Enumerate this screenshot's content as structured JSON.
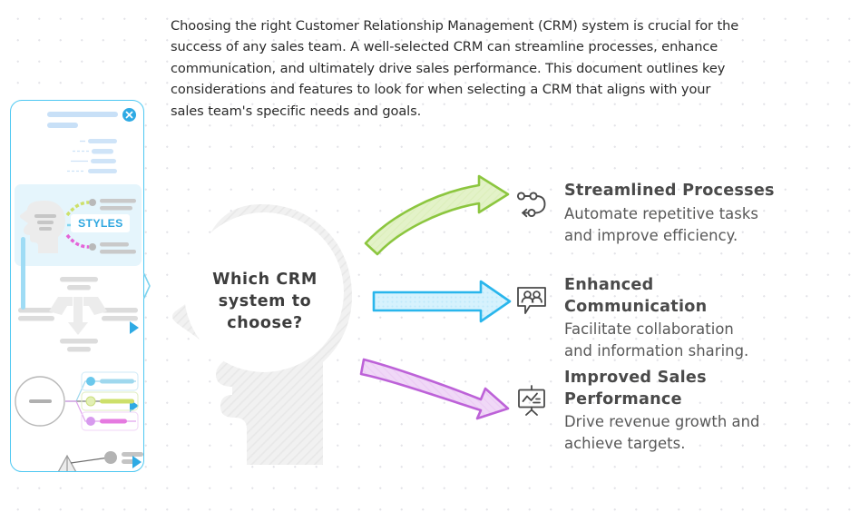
{
  "intro": {
    "paragraph": "Choosing the right Customer Relationship Management (CRM) system is crucial for the success of any sales team. A well-selected CRM can streamline processes, enhance communication, and ultimately drive sales performance. This document outlines key considerations and features to look for when selecting a CRM that aligns with your sales team's specific needs and goals."
  },
  "central": {
    "question": "Which CRM\nsystem to\nchoose?",
    "shape": "head-silhouette"
  },
  "benefits": [
    {
      "icon": "process-loop-icon",
      "title": "Streamlined Processes",
      "description": "Automate repetitive tasks\nand improve efficiency.",
      "arrow": "curved-up-arrow",
      "arrow_color": "#8cc63f"
    },
    {
      "icon": "people-speech-bubble-icon",
      "title": "Enhanced\nCommunication",
      "description": "Facilitate collaboration\nand information sharing.",
      "arrow": "straight-arrow",
      "arrow_color": "#29b6ec"
    },
    {
      "icon": "presentation-chart-icon",
      "title": "Improved Sales\nPerformance",
      "description": "Drive revenue growth and\nachieve targets.",
      "arrow": "curved-down-arrow",
      "arrow_color": "#bd62d8"
    }
  ],
  "sidebar": {
    "close_label": "✕",
    "selected_thumbnail_label": "STYLES",
    "thumbnails": [
      {
        "name": "bulleted-list-layout"
      },
      {
        "name": "styles-head-diagram-layout"
      },
      {
        "name": "split-arrows-layout"
      },
      {
        "name": "circle-branch-layout"
      },
      {
        "name": "triangle-nodes-layout"
      }
    ],
    "accent_color": "#2eaae4",
    "border_color": "#4ec8f2"
  },
  "palette": {
    "background": "#ffffff",
    "dot_grid": "#e3e3e8",
    "heading_text": "#4a4a4a",
    "body_text": "#585858",
    "head_fill": "#f0f0f0"
  }
}
